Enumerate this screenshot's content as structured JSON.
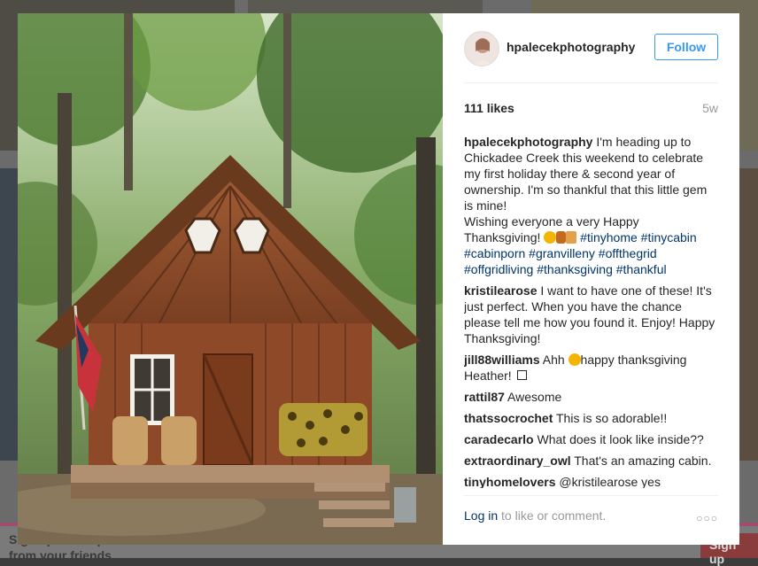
{
  "background": {
    "signup_text": "Sign up to see photos and videos\nfrom your friends.",
    "signup_button": "Sign up"
  },
  "post": {
    "username": "hpalecekphotography",
    "follow_label": "Follow",
    "likes": "111 likes",
    "age": "5w",
    "caption": {
      "user": "hpalecekphotography",
      "text": "I'm heading up to Chickadee Creek this weekend to celebrate my first holiday there & second year of ownership. I'm so thankful that this little gem is mine!",
      "text2": "Wishing everyone a very Happy Thanksgiving!",
      "hashtags": [
        "#tinyhome",
        "#tinycabin",
        "#cabinporn",
        "#granvilleny",
        "#offthegrid",
        "#offgridliving",
        "#thanksgiving",
        "#thankful"
      ]
    },
    "comments": [
      {
        "user": "kristilearose",
        "text": "I want to have one of these! It's just perfect. When you have the chance please tell me how you found it. Enjoy! Happy Thanksgiving!"
      },
      {
        "user": "jill88williams",
        "pre": "Ahh",
        "text": "happy thanksgiving Heather!"
      },
      {
        "user": "rattil87",
        "text": "Awesome"
      },
      {
        "user": "thatssocrochet",
        "text": "This is so adorable!!"
      },
      {
        "user": "caradecarlo",
        "text": "What does it look like inside??"
      },
      {
        "user": "extraordinary_owl",
        "text": "That's an amazing cabin."
      },
      {
        "user": "tinyhomelovers",
        "text": "@kristilearose yes"
      }
    ],
    "login_link": "Log in",
    "login_text": " to like or comment.",
    "more_label": "○○○"
  },
  "colors": {
    "link": "#003569",
    "accent": "#3897f0"
  }
}
